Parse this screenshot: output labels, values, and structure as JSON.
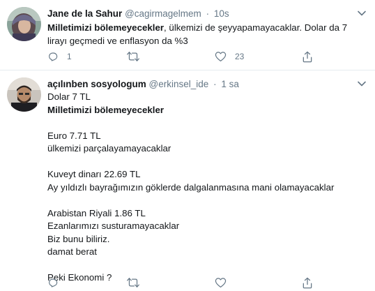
{
  "tweets": [
    {
      "author_name": "Jane de la Sahur",
      "handle": "@cagirmagelmem",
      "separator": "·",
      "time": "10s",
      "text_bold": "Milletimizi bölemeyecekler",
      "text_rest": ", ülkemizi de şeyyapamayacaklar. Dolar da 7 lirayı geçmedi ve enflasyon da %3",
      "reply_count": "1",
      "retweet_count": "",
      "like_count": "23",
      "avatar_icon": "avatar-photo-woman-hijab"
    },
    {
      "author_name": "açılınben sosyologum",
      "handle": "@erkinsel_ide",
      "separator": "·",
      "time": "1 sa",
      "lines": [
        "Dolar 7 TL",
        "Milletimizi bölemeyecekler",
        "",
        "Euro 7.71 TL",
        "ülkemizi parçalayamayacaklar",
        "",
        "Kuveyt dinarı 22.69 TL",
        "Ay yıldızlı bayrağımızın göklerde dalgalanmasına mani olamayacaklar",
        "",
        "Arabistan Riyali 1.86 TL",
        "Ezanlarımızı susturamayacaklar",
        "Biz bunu biliriz.",
        "damat berat",
        "",
        "Peki Ekonomi ?"
      ],
      "reply_count": "",
      "retweet_count": "",
      "like_count": "",
      "avatar_icon": "avatar-photo-man-beard"
    }
  ],
  "icons": {
    "reply": "reply-icon",
    "retweet": "retweet-icon",
    "like": "heart-icon",
    "share": "share-icon",
    "menu": "chevron-down-icon"
  },
  "colors": {
    "text": "#14171a",
    "secondary": "#657786",
    "divider": "#e6ecf0"
  }
}
